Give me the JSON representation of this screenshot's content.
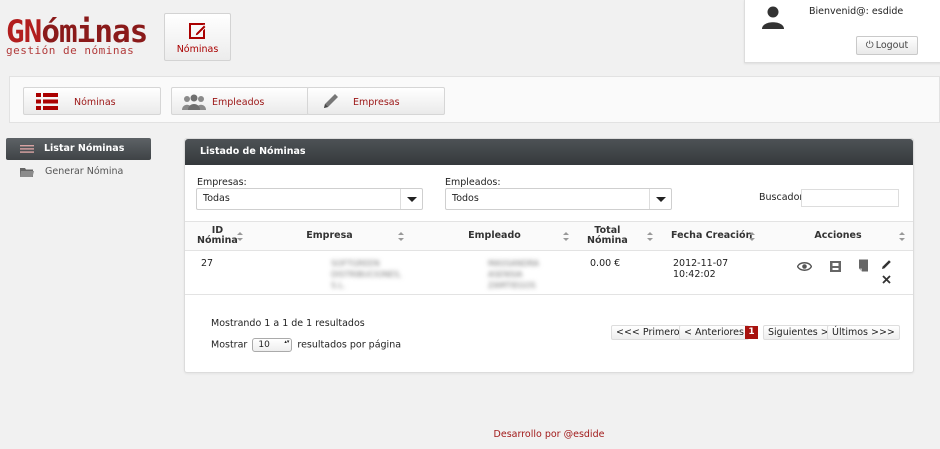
{
  "app": {
    "logo_title_first": "GN",
    "logo_title_rest": "óminas",
    "logo_subtitle": "gestión de nóminas",
    "brand_color": "#b21e1e"
  },
  "top_nav": {
    "nominas_label": "Nóminas",
    "icon": "edit-icon"
  },
  "user": {
    "welcome": "Bienvenid@: esdide",
    "logout_label": "Logout",
    "avatar_icon": "user-icon"
  },
  "menu": [
    {
      "label": "Nóminas",
      "icon": "list-icon"
    },
    {
      "label": "Empleados",
      "icon": "users-icon"
    },
    {
      "label": "Empresas",
      "icon": "pencil-icon"
    }
  ],
  "sidebar": {
    "items": [
      {
        "label": "Listar Nóminas",
        "icon": "list-icon",
        "active": true
      },
      {
        "label": "Generar Nómina",
        "icon": "folder-icon",
        "active": false
      }
    ]
  },
  "panel": {
    "title": "Listado de Nóminas",
    "filters": {
      "empresas_label": "Empresas:",
      "empresas_value": "Todas",
      "empleados_label": "Empleados:",
      "empleados_value": "Todos",
      "search_label": "Buscador",
      "search_value": ""
    },
    "columns": [
      "ID\nNómina",
      "Empresa",
      "Empleado",
      "Total\nNómina",
      "Fecha Creación",
      "Acciones"
    ],
    "rows": [
      {
        "id": "27",
        "empresa": "SOFTGREEN DISTRIBUCIONES, S.L.",
        "empleado": "MASSANDRA ASENSIA ZAMTIEGOS",
        "total": "0.00 €",
        "fecha_line1": "2012-11-07",
        "fecha_line2": "10:42:02",
        "actions": [
          "view-icon",
          "print-icon",
          "document-icon",
          "edit-icon",
          "delete-icon"
        ]
      }
    ],
    "info": "Mostrando 1 a 1 de 1 resultados",
    "length_prefix": "Mostrar",
    "length_value": "10",
    "length_suffix": "resultados por página",
    "pager": {
      "first": "<<< Primeros",
      "prev": "< Anteriores",
      "current": "1",
      "next": "Siguientes >",
      "last": "Últimos >>>"
    }
  },
  "footer": {
    "text": "Desarrollo por @esdide"
  }
}
